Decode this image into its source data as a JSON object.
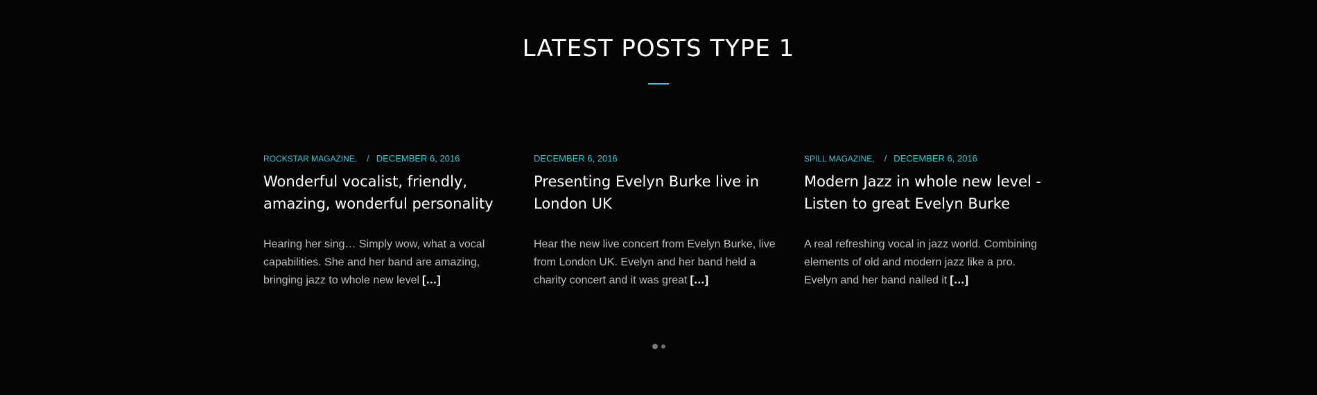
{
  "section": {
    "title": "LATEST POSTS TYPE 1"
  },
  "posts": [
    {
      "category": "ROCKSTAR MAGAZINE,",
      "separator": "/",
      "date": "DECEMBER 6, 2016",
      "title": "Wonderful vocalist, friendly, amazing, wonderful personality",
      "excerpt": "Hearing her sing… Simply wow, what a vocal capabilities. She and her band are amazing, bringing jazz to whole new level",
      "more": "[…]"
    },
    {
      "category": "",
      "separator": "",
      "date": "DECEMBER 6, 2016",
      "title": "Presenting Evelyn Burke live in London UK",
      "excerpt": "Hear the new live concert from Evelyn Burke, live from London UK. Evelyn and her band held a charity concert and it was great",
      "more": "[…]"
    },
    {
      "category": "SPILL MAGAZINE,",
      "separator": "/",
      "date": "DECEMBER 6, 2016",
      "title": "Modern Jazz in whole new level - Listen to great Evelyn Burke",
      "excerpt": "A real refreshing vocal in jazz world. Combining elements of old and modern jazz like a pro. Evelyn and her band nailed it",
      "more": "[…]"
    }
  ],
  "colors": {
    "background": "#050505",
    "accent": "#35c6cf",
    "title": "#ffffff",
    "excerpt": "#bdbdbd"
  },
  "pagination": {
    "pages": 2,
    "active": 1
  }
}
